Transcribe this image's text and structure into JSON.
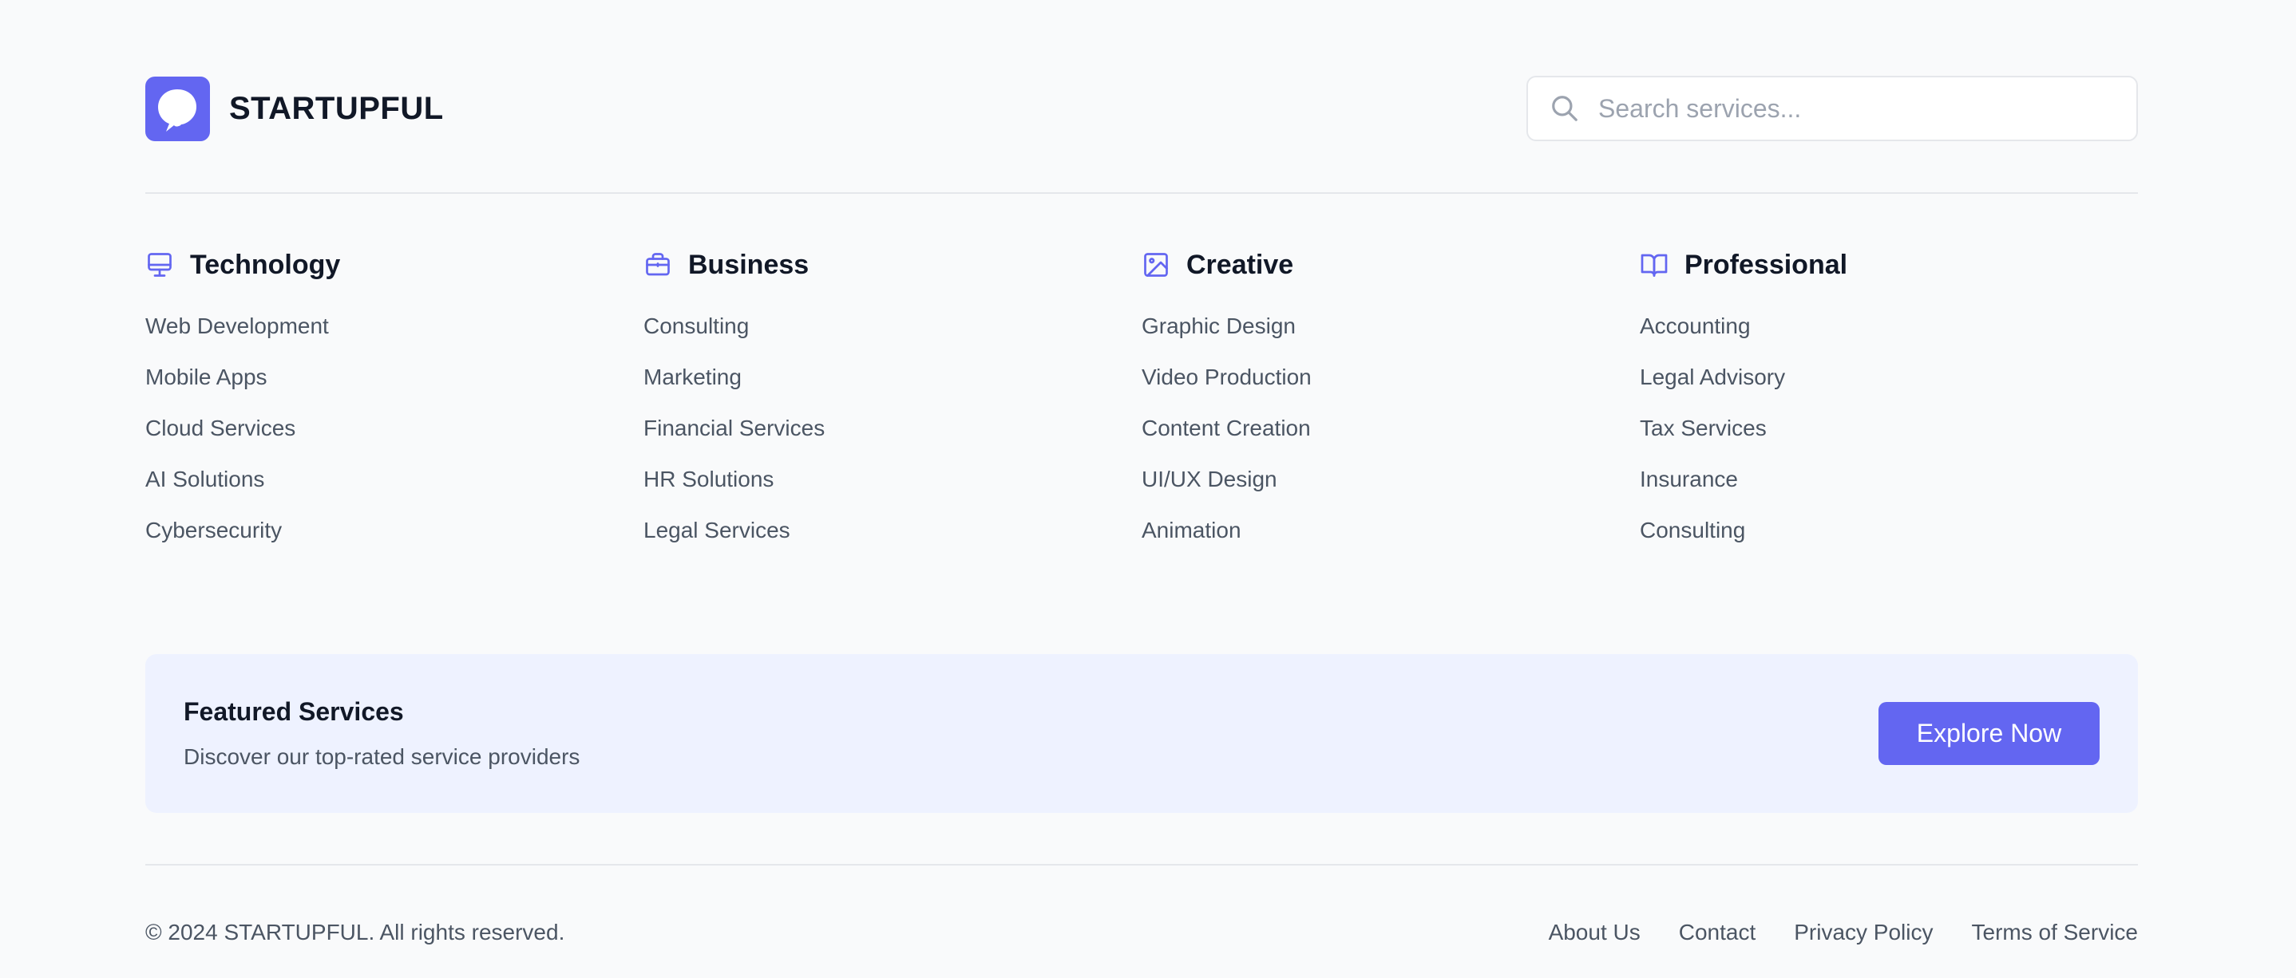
{
  "brand": {
    "name": "STARTUPFUL",
    "color": "#6366f1"
  },
  "search": {
    "placeholder": "Search services...",
    "value": ""
  },
  "categories": [
    {
      "title": "Technology",
      "icon": "monitor-icon",
      "items": [
        "Web Development",
        "Mobile Apps",
        "Cloud Services",
        "AI Solutions",
        "Cybersecurity"
      ]
    },
    {
      "title": "Business",
      "icon": "briefcase-icon",
      "items": [
        "Consulting",
        "Marketing",
        "Financial Services",
        "HR Solutions",
        "Legal Services"
      ]
    },
    {
      "title": "Creative",
      "icon": "image-icon",
      "items": [
        "Graphic Design",
        "Video Production",
        "Content Creation",
        "UI/UX Design",
        "Animation"
      ]
    },
    {
      "title": "Professional",
      "icon": "book-open-icon",
      "items": [
        "Accounting",
        "Legal Advisory",
        "Tax Services",
        "Insurance",
        "Consulting"
      ]
    }
  ],
  "featured": {
    "title": "Featured Services",
    "description": "Discover our top-rated service providers",
    "button_label": "Explore Now"
  },
  "footer": {
    "copyright": "© 2024 STARTUPFUL. All rights reserved.",
    "links": [
      "About Us",
      "Contact",
      "Privacy Policy",
      "Terms of Service"
    ]
  }
}
